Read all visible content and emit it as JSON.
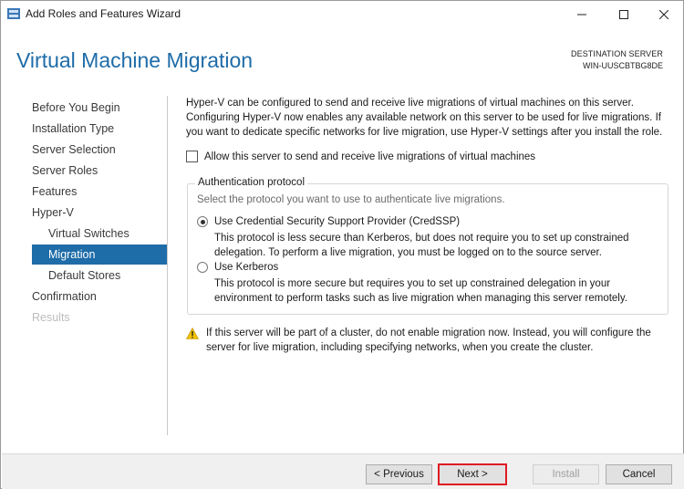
{
  "window": {
    "title": "Add Roles and Features Wizard",
    "controls": {
      "minimize": "—",
      "maximize": "☐",
      "close": "✕"
    }
  },
  "header": {
    "title": "Virtual Machine Migration",
    "destination_label": "DESTINATION SERVER",
    "destination_server": "WIN-UUSCBTBG8DE"
  },
  "nav": {
    "items": [
      {
        "label": "Before You Begin",
        "level": 0,
        "state": "normal"
      },
      {
        "label": "Installation Type",
        "level": 0,
        "state": "normal"
      },
      {
        "label": "Server Selection",
        "level": 0,
        "state": "normal"
      },
      {
        "label": "Server Roles",
        "level": 0,
        "state": "normal"
      },
      {
        "label": "Features",
        "level": 0,
        "state": "normal"
      },
      {
        "label": "Hyper-V",
        "level": 0,
        "state": "normal"
      },
      {
        "label": "Virtual Switches",
        "level": 1,
        "state": "normal"
      },
      {
        "label": "Migration",
        "level": 1,
        "state": "active"
      },
      {
        "label": "Default Stores",
        "level": 1,
        "state": "normal"
      },
      {
        "label": "Confirmation",
        "level": 0,
        "state": "normal"
      },
      {
        "label": "Results",
        "level": 0,
        "state": "disabled"
      }
    ]
  },
  "content": {
    "intro": "Hyper-V can be configured to send and receive live migrations of virtual machines on this server. Configuring Hyper-V now enables any available network on this server to be used for live migrations. If you want to dedicate specific networks for live migration, use Hyper-V settings after you install the role.",
    "allow_checkbox": {
      "label": "Allow this server to send and receive live migrations of virtual machines",
      "checked": false
    },
    "auth": {
      "title": "Authentication protocol",
      "description": "Select the protocol you want to use to authenticate live migrations.",
      "options": [
        {
          "label": "Use Credential Security Support Provider (CredSSP)",
          "description": "This protocol is less secure than Kerberos, but does not require you to set up constrained delegation. To perform a live migration, you must be logged on to the source server.",
          "selected": true
        },
        {
          "label": "Use Kerberos",
          "description": "This protocol is more secure but requires you to set up constrained delegation in your environment to perform tasks such as live migration when managing this server remotely.",
          "selected": false
        }
      ]
    },
    "warning": "If this server will be part of a cluster, do not enable migration now. Instead, you will configure the server for live migration, including specifying networks, when you create the cluster."
  },
  "footer": {
    "previous": "< Previous",
    "next": "Next >",
    "install": "Install",
    "cancel": "Cancel"
  },
  "colors": {
    "accent": "#1e6ca8",
    "highlight_border": "#e01b24",
    "warning": "#f2c200"
  }
}
